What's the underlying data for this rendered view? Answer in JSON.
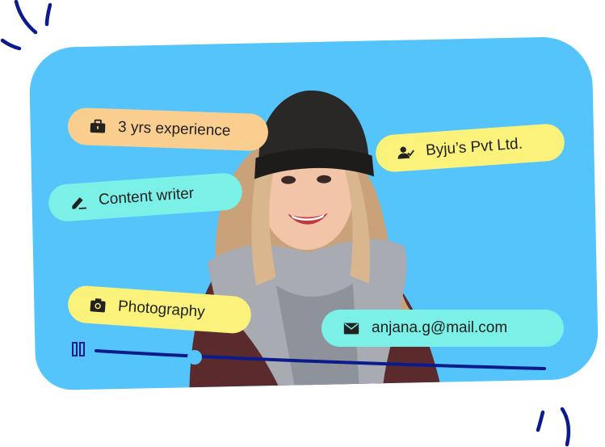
{
  "colors": {
    "card_bg": "#55C4FB",
    "deco_stroke": "#0B1A8C",
    "pill_experience": "#F9CE8F",
    "pill_company": "#FBF27B",
    "pill_role": "#7BF0E6",
    "pill_hobby": "#FBF27B",
    "pill_email": "#7BF0E6",
    "track": "#0B1A8C"
  },
  "tags": {
    "experience": {
      "label": "3 yrs experience",
      "icon": "briefcase-icon"
    },
    "company": {
      "label": "Byju’s Pvt Ltd.",
      "icon": "person-check-icon"
    },
    "role": {
      "label": "Content writer",
      "icon": "pen-icon"
    },
    "hobby": {
      "label": "Photography",
      "icon": "camera-icon"
    },
    "email": {
      "label": "anjana.g@mail.com",
      "icon": "mail-icon"
    }
  },
  "player": {
    "pause_icon": "pause-icon",
    "progress": 0.22
  }
}
